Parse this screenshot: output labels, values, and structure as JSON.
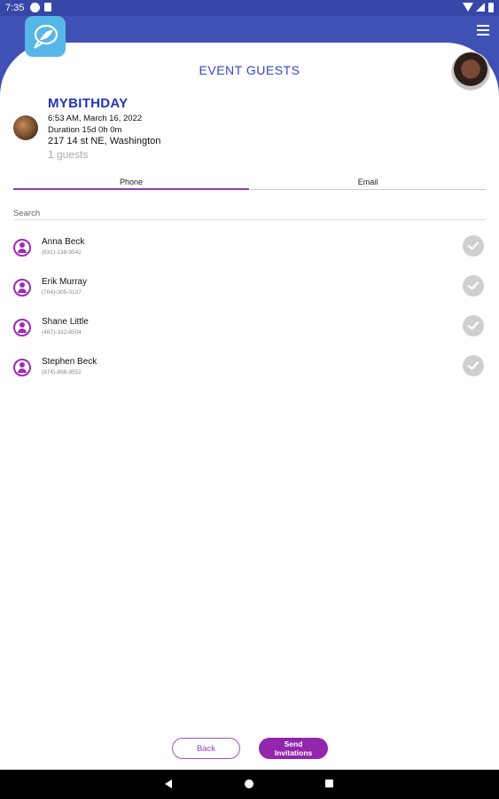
{
  "status_bar": {
    "time": "7:35"
  },
  "header": {
    "title": "EVENT GUESTS",
    "logo_icon": "leaf-chat-logo",
    "menu_icon": "hamburger-menu-icon"
  },
  "event": {
    "name": "MYBITHDAY",
    "datetime": "6:53 AM, March 16, 2022",
    "duration": "Duration 15d 0h 0m",
    "address": "217 14 st NE, Washington",
    "guests": "1 guests"
  },
  "tabs": [
    {
      "label": "Phone",
      "active": true
    },
    {
      "label": "Email",
      "active": false
    }
  ],
  "search": {
    "placeholder": "Search"
  },
  "contacts": [
    {
      "name": "Anna Beck",
      "phone": "(631)-138-9542"
    },
    {
      "name": "Erik Murray",
      "phone": "(704)-005-0137"
    },
    {
      "name": "Shane Little",
      "phone": "(487)-332-8504"
    },
    {
      "name": "Stephen Beck",
      "phone": "(874)-898-9552"
    }
  ],
  "buttons": {
    "back": "Back",
    "send_line1": "Send",
    "send_line2": "Invitations"
  },
  "colors": {
    "header_blue": "#3f51b5",
    "title_blue": "#3346c2",
    "accent_purple": "#9226ad",
    "check_grey": "#cfcfcf"
  }
}
